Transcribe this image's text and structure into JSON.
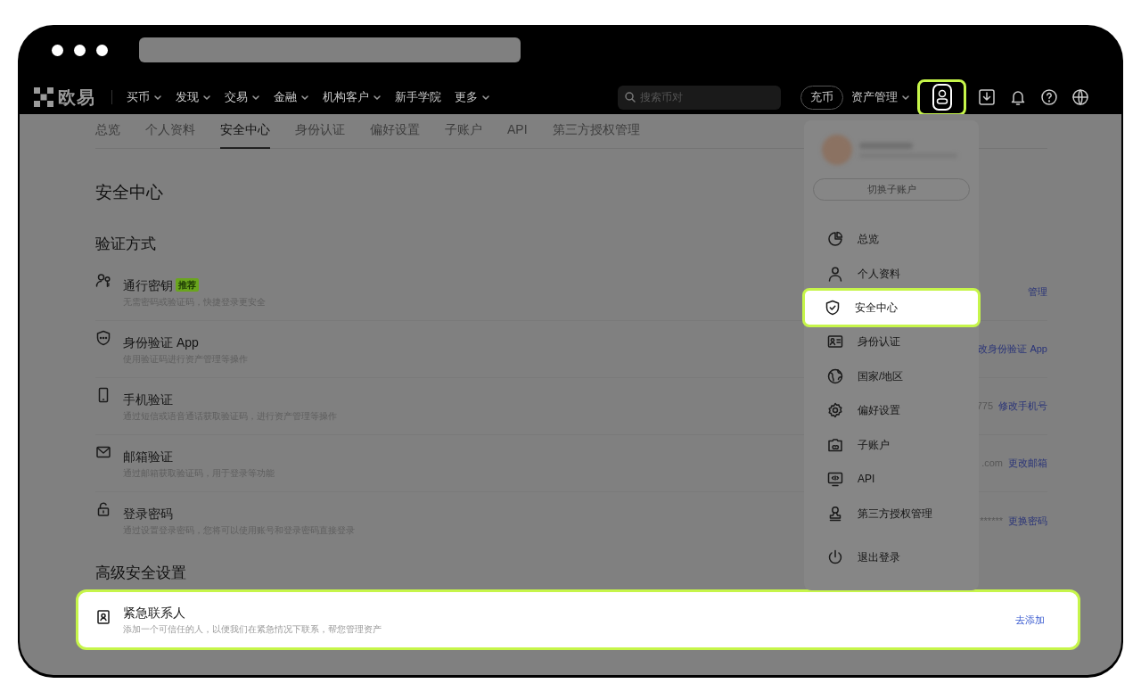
{
  "nav": {
    "logo": "欧易",
    "menu": [
      {
        "label": "买币",
        "dropdown": true
      },
      {
        "label": "发现",
        "dropdown": true
      },
      {
        "label": "交易",
        "dropdown": true
      },
      {
        "label": "金融",
        "dropdown": true
      },
      {
        "label": "机构客户",
        "dropdown": true
      },
      {
        "label": "新手学院",
        "dropdown": false
      },
      {
        "label": "更多",
        "dropdown": true
      }
    ],
    "search": {
      "placeholder": "搜索币对"
    },
    "deposit": "充币",
    "assets": "资产管理",
    "account_button": {
      "highlighted": true
    }
  },
  "tabs": [
    {
      "label": "总览",
      "selected": false
    },
    {
      "label": "个人资料",
      "selected": false
    },
    {
      "label": "安全中心",
      "selected": true
    },
    {
      "label": "身份认证",
      "selected": false
    },
    {
      "label": "偏好设置",
      "selected": false
    },
    {
      "label": "子账户",
      "selected": false
    },
    {
      "label": "API",
      "selected": false
    },
    {
      "label": "第三方授权管理",
      "selected": false
    }
  ],
  "page_title": "安全中心",
  "verification": {
    "heading": "验证方式",
    "items": [
      {
        "kind": "passkey",
        "title": "通行密钥",
        "badge": "推荐",
        "description": "无需密码或验证码，快捷登录更安全",
        "action": "管理"
      },
      {
        "kind": "authenticator",
        "title": "身份验证 App",
        "description": "使用验证码进行资产管理等操作",
        "action": "改身份验证 App"
      },
      {
        "kind": "phone",
        "title": "手机验证",
        "description": "通过短信或语音通话获取验证码，进行资产管理等操作",
        "value": "775",
        "action": "修改手机号"
      },
      {
        "kind": "email",
        "title": "邮箱验证",
        "description": "通过邮箱获取验证码，用于登录等功能",
        "value": ".com",
        "action": "更改邮箱"
      },
      {
        "kind": "password",
        "title": "登录密码",
        "description": "通过设置登录密码，您将可以使用账号和登录密码直接登录",
        "value": "******",
        "action": "更换密码"
      }
    ]
  },
  "advanced": {
    "heading": "高级安全设置",
    "items": [
      {
        "kind": "contact",
        "title": "紧急联系人",
        "description": "添加一个可信任的人，以便我们在紧急情况下联系，帮您管理资产",
        "action": "去添加",
        "highlighted": true
      }
    ]
  },
  "account_menu": {
    "switch_button": "切换子账户",
    "items": [
      {
        "kind": "overview",
        "label": "总览",
        "highlighted": false
      },
      {
        "kind": "profile",
        "label": "个人资料",
        "highlighted": false
      },
      {
        "kind": "security",
        "label": "安全中心",
        "highlighted": true
      },
      {
        "kind": "identity",
        "label": "身份认证",
        "highlighted": false
      },
      {
        "kind": "region",
        "label": "国家/地区",
        "highlighted": false
      },
      {
        "kind": "preferences",
        "label": "偏好设置",
        "highlighted": false
      },
      {
        "kind": "subaccount",
        "label": "子账户",
        "highlighted": false
      },
      {
        "kind": "api",
        "label": "API",
        "highlighted": false
      },
      {
        "kind": "authorization",
        "label": "第三方授权管理",
        "highlighted": false
      },
      {
        "kind": "logout",
        "label": "退出登录",
        "highlighted": false
      }
    ]
  }
}
